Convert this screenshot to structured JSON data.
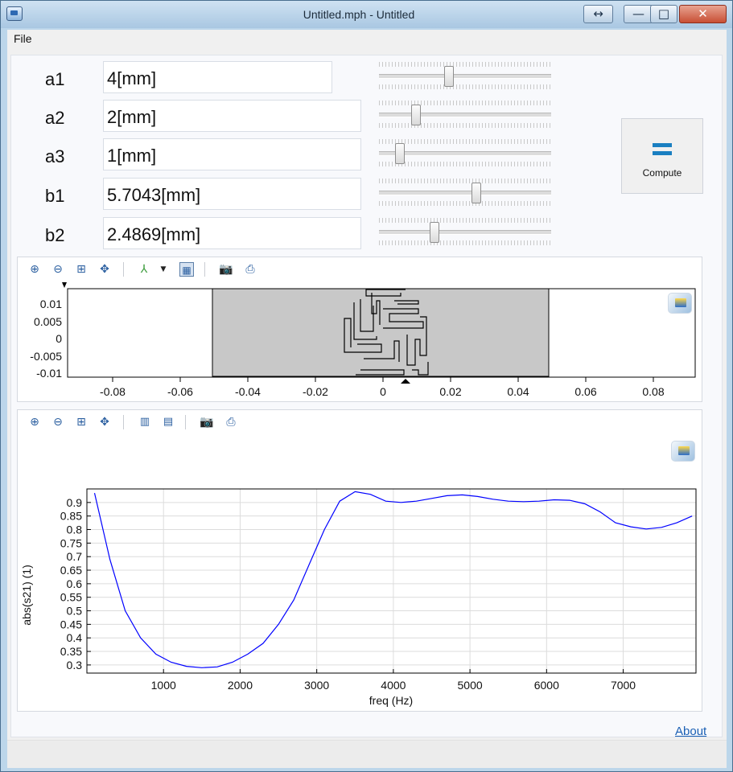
{
  "window": {
    "title": "Untitled.mph - Untitled",
    "restore_glyph": "↔",
    "minimize_glyph": "—",
    "maximize_glyph": "□",
    "close_glyph": "✕"
  },
  "menu": {
    "file": "File"
  },
  "params": [
    {
      "label": "a1",
      "value": "4[mm]",
      "slider_fraction": 0.4
    },
    {
      "label": "a2",
      "value": "2[mm]",
      "slider_fraction": 0.2
    },
    {
      "label": "a3",
      "value": "1[mm]",
      "slider_fraction": 0.1
    },
    {
      "label": "b1",
      "value": "5.7043[mm]",
      "slider_fraction": 0.57
    },
    {
      "label": "b2",
      "value": "2.4869[mm]",
      "slider_fraction": 0.31
    }
  ],
  "compute": {
    "label": "Compute",
    "icon": "equals-icon"
  },
  "geometry_view": {
    "toolbar": [
      "zoom-in-icon",
      "zoom-out-icon",
      "zoom-box-icon",
      "zoom-extents-icon",
      "axis-orientation-icon",
      "grid-toggle-icon",
      "camera-icon",
      "print-icon"
    ],
    "x_ticks": [
      "-0.08",
      "-0.06",
      "-0.04",
      "-0.02",
      "0",
      "0.02",
      "0.04",
      "0.06",
      "0.08"
    ],
    "y_ticks": [
      "0.01",
      "0.005",
      "0",
      "-0.005",
      "-0.01"
    ]
  },
  "plot_view": {
    "toolbar": [
      "zoom-in-icon",
      "zoom-out-icon",
      "zoom-box-icon",
      "zoom-extents-icon",
      "vertical-grid-icon",
      "horizontal-grid-icon",
      "camera-icon",
      "print-icon"
    ]
  },
  "chart_data": {
    "type": "line",
    "xlabel": "freq (Hz)",
    "ylabel": "abs(s21) (1)",
    "xlim": [
      0,
      7950
    ],
    "ylim": [
      0.27,
      0.95
    ],
    "x_ticks": [
      1000,
      2000,
      3000,
      4000,
      5000,
      6000,
      7000
    ],
    "y_ticks": [
      0.3,
      0.35,
      0.4,
      0.45,
      0.5,
      0.55,
      0.6,
      0.65,
      0.7,
      0.75,
      0.8,
      0.85,
      0.9
    ],
    "grid": true,
    "series": [
      {
        "color": "#0000ff",
        "x": [
          100,
          300,
          500,
          700,
          900,
          1100,
          1300,
          1500,
          1700,
          1900,
          2100,
          2300,
          2500,
          2700,
          2900,
          3100,
          3300,
          3500,
          3700,
          3900,
          4100,
          4300,
          4500,
          4700,
          4900,
          5100,
          5300,
          5500,
          5700,
          5900,
          6100,
          6300,
          6500,
          6700,
          6900,
          7100,
          7300,
          7500,
          7700,
          7900
        ],
        "y": [
          0.935,
          0.69,
          0.5,
          0.4,
          0.34,
          0.31,
          0.295,
          0.29,
          0.293,
          0.31,
          0.34,
          0.38,
          0.45,
          0.54,
          0.67,
          0.8,
          0.905,
          0.94,
          0.93,
          0.905,
          0.9,
          0.905,
          0.915,
          0.925,
          0.928,
          0.922,
          0.912,
          0.905,
          0.903,
          0.905,
          0.91,
          0.908,
          0.895,
          0.865,
          0.825,
          0.81,
          0.802,
          0.808,
          0.825,
          0.85
        ]
      }
    ]
  },
  "about": "About"
}
